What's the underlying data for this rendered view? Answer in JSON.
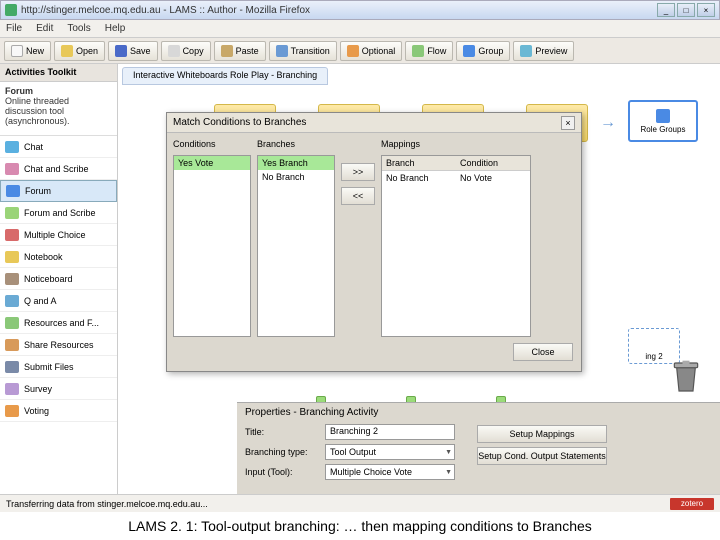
{
  "window": {
    "title": "http://stinger.melcoe.mq.edu.au - LAMS :: Author - Mozilla Firefox",
    "min": "_",
    "max": "□",
    "close": "×"
  },
  "menu": {
    "file": "File",
    "edit": "Edit",
    "tools": "Tools",
    "help": "Help"
  },
  "toolbar": {
    "new": "New",
    "open": "Open",
    "save": "Save",
    "copy": "Copy",
    "paste": "Paste",
    "transition": "Transition",
    "optional": "Optional",
    "flow": "Flow",
    "group": "Group",
    "preview": "Preview"
  },
  "sidebar": {
    "header": "Activities Toolkit",
    "desc_title": "Forum",
    "desc_body": "Online threaded discussion tool (asynchronous).",
    "items": [
      {
        "label": "Chat",
        "color": "#5ab0e0"
      },
      {
        "label": "Chat and Scribe",
        "color": "#d88ab0"
      },
      {
        "label": "Forum",
        "color": "#4a8ae4"
      },
      {
        "label": "Forum and Scribe",
        "color": "#9ad478"
      },
      {
        "label": "Multiple Choice",
        "color": "#d86a6a"
      },
      {
        "label": "Notebook",
        "color": "#e8c858"
      },
      {
        "label": "Noticeboard",
        "color": "#a8907a"
      },
      {
        "label": "Q and A",
        "color": "#6aaad4"
      },
      {
        "label": "Resources and F...",
        "color": "#8ac878"
      },
      {
        "label": "Share Resources",
        "color": "#d89a5a"
      },
      {
        "label": "Submit Files",
        "color": "#7a8aa8"
      },
      {
        "label": "Survey",
        "color": "#b89ad4"
      },
      {
        "label": "Voting",
        "color": "#e89a4a"
      }
    ]
  },
  "canvas": {
    "tab": "Interactive Whiteboards Role Play - Branching",
    "group_label": "Role Groups",
    "seq_label": "ing 2"
  },
  "dialog": {
    "title": "Match Conditions to Branches",
    "col_conditions": "Conditions",
    "col_branches": "Branches",
    "col_mappings": "Mappings",
    "map_head_branch": "Branch",
    "map_head_cond": "Condition",
    "conditions": [
      "Yes Vote"
    ],
    "branches": [
      "Yes Branch",
      "No Branch"
    ],
    "mappings": [
      {
        "branch": "No Branch",
        "cond": "No Vote"
      }
    ],
    "add": ">>",
    "remove": "<<",
    "close": "Close",
    "x": "×"
  },
  "props": {
    "title": "Properties - Branching Activity",
    "lbl_title": "Title:",
    "val_title": "Branching 2",
    "lbl_type": "Branching type:",
    "val_type": "Tool Output",
    "lbl_input": "Input (Tool):",
    "val_input": "Multiple Choice Vote",
    "btn_mappings": "Setup Mappings",
    "btn_cond": "Setup Cond. Output Statements"
  },
  "status": {
    "left": "Transferring data from stinger.melcoe.mq.edu.au...",
    "zotero": "zotero"
  },
  "caption": "LAMS 2. 1: Tool-output branching: … then mapping conditions to Branches"
}
